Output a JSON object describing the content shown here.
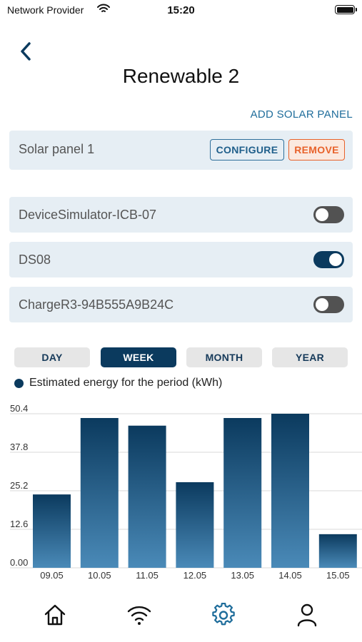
{
  "status_bar": {
    "carrier": "Network Provider",
    "time": "15:20",
    "icons": [
      "wifi-icon",
      "battery-icon"
    ]
  },
  "header": {
    "back_icon": "chevron-left-icon",
    "title": "Renewable 2"
  },
  "solar": {
    "add_label": "ADD SOLAR PANEL",
    "panels": [
      {
        "name": "Solar panel 1",
        "configure_label": "CONFIGURE",
        "remove_label": "REMOVE"
      }
    ]
  },
  "devices": [
    {
      "name": "DeviceSimulator-ICB-07",
      "enabled": false
    },
    {
      "name": "DS08",
      "enabled": true
    },
    {
      "name": "ChargeR3-94B555A9B24C",
      "enabled": false
    }
  ],
  "period_tabs": {
    "items": [
      "DAY",
      "WEEK",
      "MONTH",
      "YEAR"
    ],
    "selected": "WEEK"
  },
  "colors": {
    "accent": "#0b3a5e",
    "link": "#1f6d9b",
    "remove": "#e8622a",
    "card": "#e6eef4",
    "bar_top": "#0b3a5e",
    "bar_bottom": "#4a8ab8"
  },
  "chart_data": {
    "type": "bar",
    "categories": [
      "09.05",
      "10.05",
      "11.05",
      "12.05",
      "13.05",
      "14.05",
      "15.05"
    ],
    "series": [
      {
        "name": "Estimated energy for the period (kWh)",
        "values": [
          24.0,
          49.0,
          46.5,
          28.0,
          49.0,
          50.4,
          11.0
        ]
      }
    ],
    "y_ticks": [
      "50.4",
      "37.8",
      "25.2",
      "12.6",
      "0.00"
    ],
    "ylim": [
      0,
      50.4
    ],
    "grid": true,
    "legend_placement": "top-left"
  },
  "bottom_nav": {
    "items": [
      {
        "icon": "home-icon",
        "active": false
      },
      {
        "icon": "wifi-icon",
        "active": false
      },
      {
        "icon": "gear-icon",
        "active": true
      },
      {
        "icon": "user-icon",
        "active": false
      }
    ]
  }
}
